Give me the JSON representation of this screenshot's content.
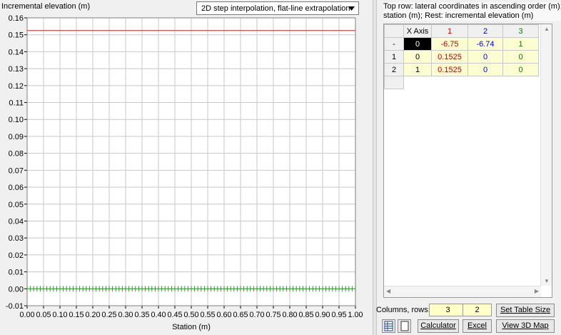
{
  "chart": {
    "y_title": "Incremental elevation (m)",
    "x_title": "Station (m)",
    "interpolation": "2D step interpolation, flat-line extrapolation",
    "y_ticks": [
      "0.16",
      "0.15",
      "0.14",
      "0.13",
      "0.12",
      "0.11",
      "0.10",
      "0.09",
      "0.08",
      "0.07",
      "0.06",
      "0.05",
      "0.04",
      "0.03",
      "0.02",
      "0.01",
      "0.00",
      "-0.01"
    ],
    "x_ticks": [
      "0.00",
      "0.05",
      "0.10",
      "0.15",
      "0.20",
      "0.25",
      "0.30",
      "0.35",
      "0.40",
      "0.45",
      "0.50",
      "0.55",
      "0.60",
      "0.65",
      "0.70",
      "0.75",
      "0.80",
      "0.85",
      "0.90",
      "0.95",
      "1.00"
    ],
    "colors": {
      "red_line": "#cc2222",
      "green_line": "#2f9a2f",
      "grid": "#c8c8c8"
    }
  },
  "chart_data": {
    "type": "line",
    "xlabel": "Station (m)",
    "ylabel": "Incremental elevation (m)",
    "xlim": [
      0,
      1
    ],
    "ylim": [
      -0.01,
      0.16
    ],
    "grid": true,
    "series": [
      {
        "x": [
          0,
          1
        ],
        "values": [
          0.1525,
          0.1525
        ],
        "color": "#cc2222"
      },
      {
        "x": [
          0,
          1
        ],
        "values": [
          0,
          0
        ],
        "color": "#2f9a2f"
      }
    ]
  },
  "panel": {
    "description_line1": "Top row: lateral coordinates in ascending order (m); X",
    "description_line2": "station (m); Rest: incremental elevation (m)"
  },
  "table": {
    "headers": [
      "X Axis",
      "1",
      "2",
      "3"
    ],
    "header_colors": [
      "#000000",
      "#cc0000",
      "#0000cc",
      "#008000"
    ],
    "rows": [
      {
        "label": "-",
        "cells": [
          "0",
          "-6.75",
          "-6.74",
          "1"
        ]
      },
      {
        "label": "1",
        "cells": [
          "0",
          "0.1525",
          "0",
          "0"
        ]
      },
      {
        "label": "2",
        "cells": [
          "1",
          "0.1525",
          "0",
          "0"
        ]
      }
    ]
  },
  "controls": {
    "columns_rows_label": "Columns, rows:",
    "columns_value": "3",
    "rows_value": "2",
    "set_table_size_label": "Set Table Size",
    "calculator_label": "Calculator",
    "excel_label": "Excel",
    "view3d_label": "View 3D Map"
  }
}
